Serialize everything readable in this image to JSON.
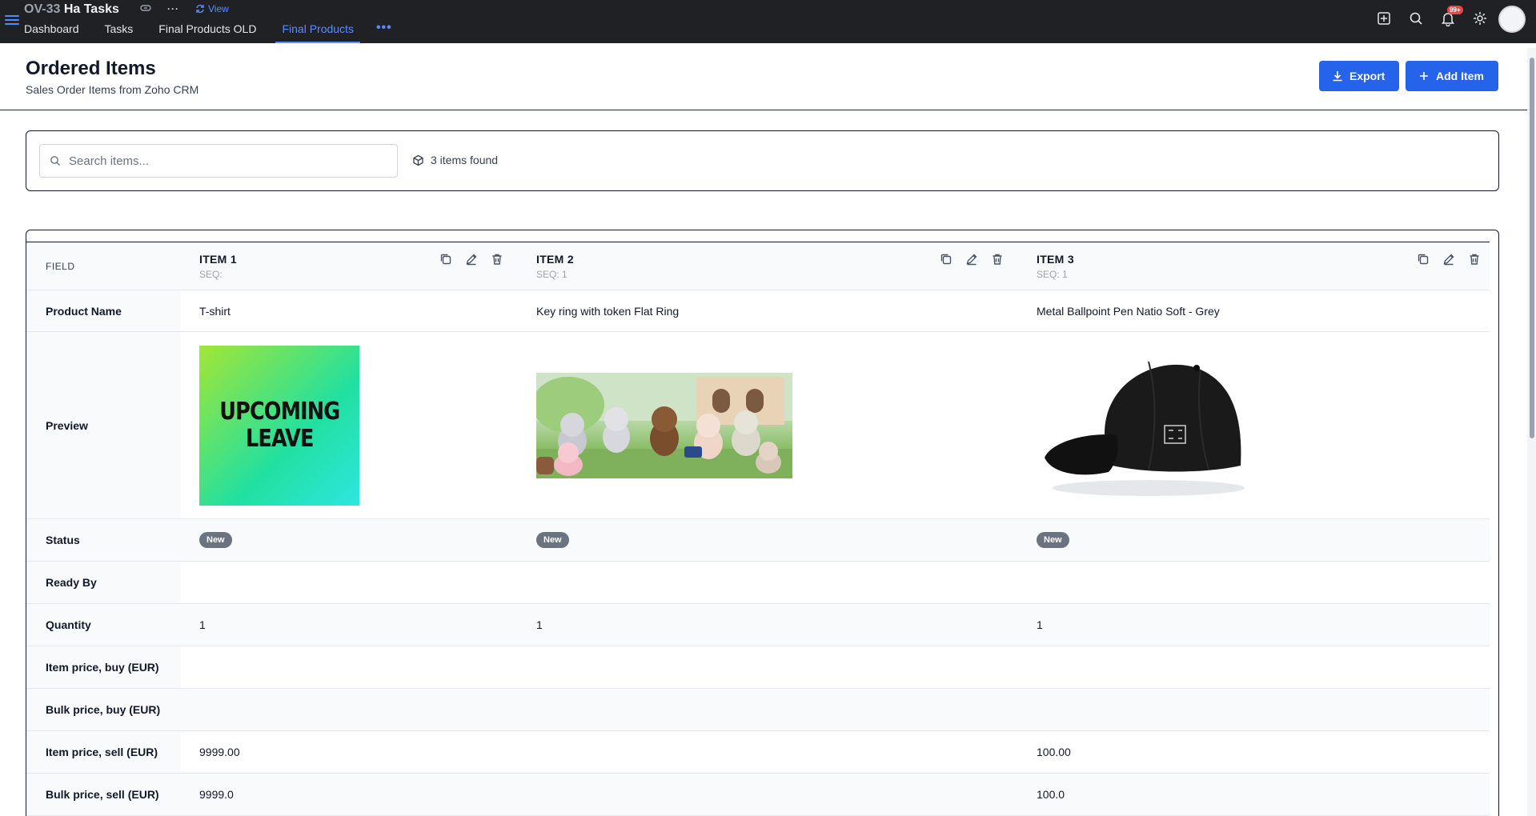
{
  "topbar": {
    "code": "OV-33",
    "title": "Ha Tasks",
    "view_label": "View",
    "tabs": [
      {
        "label": "Dashboard"
      },
      {
        "label": "Tasks"
      },
      {
        "label": "Final Products OLD"
      },
      {
        "label": "Final Products"
      }
    ],
    "more_label": "•••",
    "notification_badge": "99+",
    "accent": "#5b8cff"
  },
  "header": {
    "title": "Ordered Items",
    "subtitle": "Sales Order Items from Zoho CRM",
    "export_label": "Export",
    "add_label": "Add Item",
    "button_color": "#2563eb"
  },
  "search": {
    "placeholder": "Search items...",
    "value": "",
    "found_text": "3 items found"
  },
  "table": {
    "field_header": "FIELD",
    "items": [
      {
        "title": "ITEM 1",
        "seq": "SEQ:"
      },
      {
        "title": "ITEM 2",
        "seq": "SEQ: 1"
      },
      {
        "title": "ITEM 3",
        "seq": "SEQ: 1"
      }
    ],
    "image_1_text": "UPCOMING LEAVE",
    "rows": [
      {
        "field": "Product Name",
        "values": [
          "T-shirt",
          "Key ring with token Flat Ring",
          "Metal Ballpoint Pen Natio Soft - Grey"
        ]
      },
      {
        "field": "Preview",
        "values": [
          "",
          "",
          ""
        ]
      },
      {
        "field": "Status",
        "values": [
          "New",
          "New",
          "New"
        ]
      },
      {
        "field": "Ready By",
        "values": [
          "",
          "",
          ""
        ]
      },
      {
        "field": "Quantity",
        "values": [
          "1",
          "1",
          "1"
        ]
      },
      {
        "field": "Item price, buy (EUR)",
        "values": [
          "",
          "",
          ""
        ]
      },
      {
        "field": "Bulk price, buy (EUR)",
        "values": [
          "",
          "",
          ""
        ]
      },
      {
        "field": "Item price, sell (EUR)",
        "values": [
          "9999.00",
          "",
          "100.00"
        ]
      },
      {
        "field": "Bulk price, sell (EUR)",
        "values": [
          "9999.0",
          "",
          "100.0"
        ]
      }
    ]
  }
}
